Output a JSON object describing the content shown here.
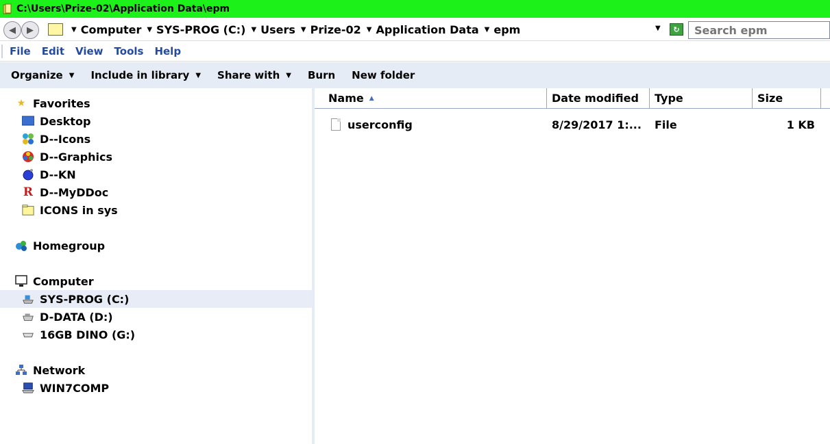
{
  "window": {
    "title": "C:\\Users\\Prize-02\\Application Data\\epm"
  },
  "address": {
    "crumbs": [
      "Computer",
      "SYS-PROG (C:)",
      "Users",
      "Prize-02",
      "Application Data",
      "epm"
    ],
    "search_placeholder": "Search epm"
  },
  "menu": [
    "File",
    "Edit",
    "View",
    "Tools",
    "Help"
  ],
  "commands": {
    "organize": "Organize",
    "include": "Include in library",
    "share": "Share with",
    "burn": "Burn",
    "new_folder": "New folder"
  },
  "nav": {
    "favorites": {
      "label": "Favorites",
      "items": [
        "Desktop",
        "D--Icons",
        "D--Graphics",
        "D--KN",
        "D--MyDDoc",
        "ICONS in sys"
      ]
    },
    "homegroup": "Homegroup",
    "computer": {
      "label": "Computer",
      "items": [
        "SYS-PROG (C:)",
        "D-DATA (D:)",
        "16GB DINO (G:)"
      ]
    },
    "network": {
      "label": "Network",
      "items": [
        "WIN7COMP"
      ]
    }
  },
  "columns": {
    "name": "Name",
    "date": "Date modified",
    "type": "Type",
    "size": "Size"
  },
  "files": [
    {
      "name": "userconfig",
      "date": "8/29/2017 1:...",
      "type": "File",
      "size": "1 KB"
    }
  ],
  "colors": {
    "title_bar": "#1cf21a",
    "menu_text": "#244b9e",
    "command_bar": "#e6ecf6"
  }
}
